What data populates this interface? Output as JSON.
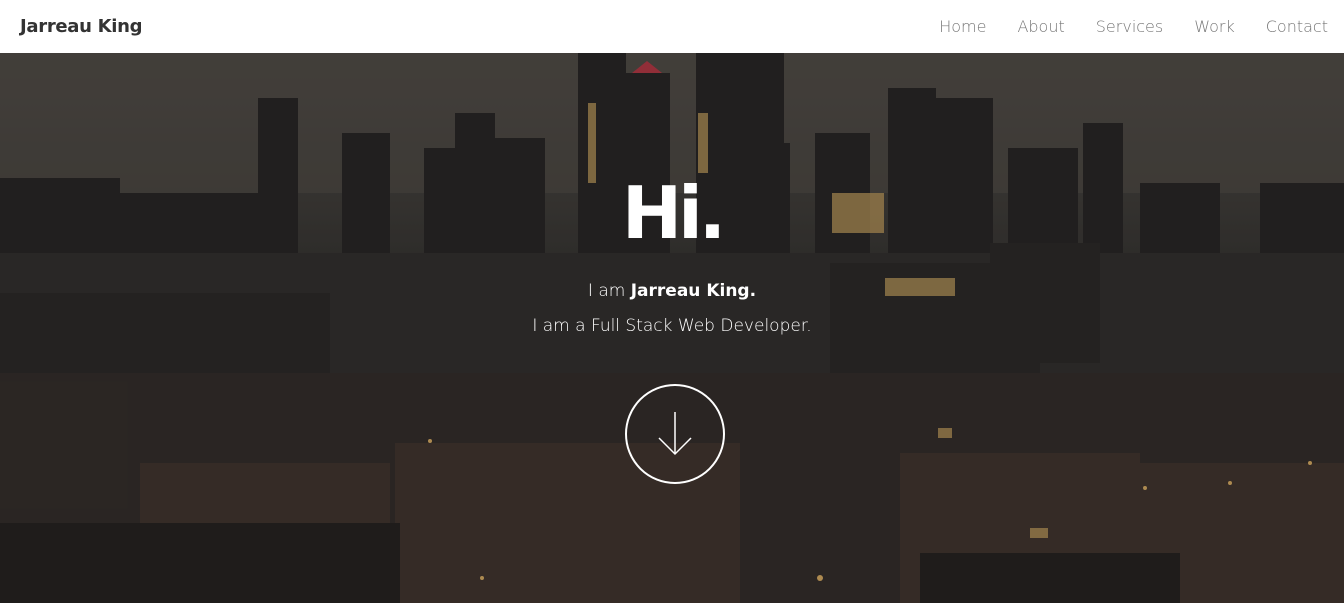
{
  "navbar": {
    "brand": "Jarreau King",
    "links": [
      {
        "label": "Home"
      },
      {
        "label": "About"
      },
      {
        "label": "Services"
      },
      {
        "label": "Work"
      },
      {
        "label": "Contact"
      }
    ]
  },
  "hero": {
    "heading": "Hi.",
    "intro_prefix": "I am ",
    "intro_name": "Jarreau King.",
    "tagline": "I am a Full Stack Web Developer.",
    "scroll_icon": "arrow-down-icon",
    "background": "city-skyline-dusk"
  },
  "colors": {
    "nav_bg": "#ffffff",
    "brand_text": "#333333",
    "nav_link": "#777777",
    "hero_text": "#ffffff"
  }
}
